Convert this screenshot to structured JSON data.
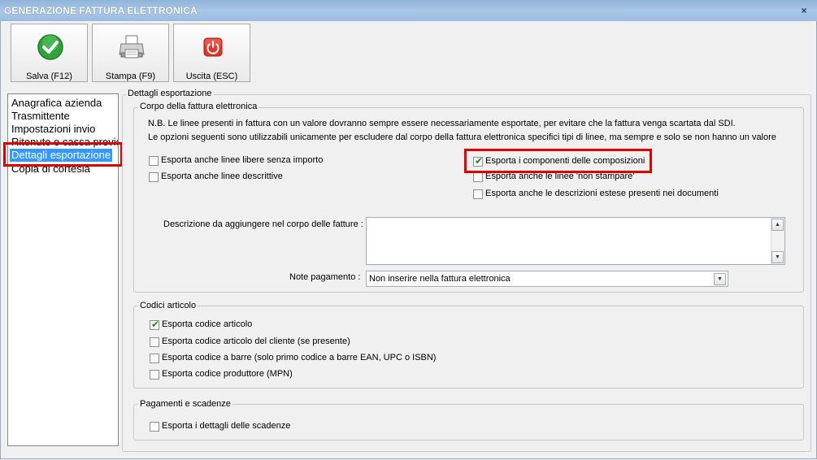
{
  "window": {
    "title": "GENERAZIONE FATTURA ELETTRONICA",
    "close_glyph": "×"
  },
  "toolbar": {
    "save_label": "Salva (F12)",
    "print_label": "Stampa (F9)",
    "exit_label": "Uscita (ESC)"
  },
  "nav": {
    "items": [
      {
        "label": "Anagrafica azienda"
      },
      {
        "label": "Trasmittente"
      },
      {
        "label": "Impostazioni invio"
      },
      {
        "label": "Ritenute e cassa previd"
      },
      {
        "label": "Dettagli esportazione"
      },
      {
        "label": "Copia di cortesia"
      }
    ],
    "selected": "Dettagli esportazione"
  },
  "main": {
    "title": "Dettagli esportazione",
    "corpo": {
      "title": "Corpo della fattura elettronica",
      "note1": "N.B. Le linee presenti in fattura con un valore dovranno sempre essere necessariamente esportate, per evitare che la fattura venga scartata dal SDI.",
      "note2": "Le opzioni seguenti sono utilizzabili unicamente per escludere dal corpo della fattura elettronica specifici tipi di linee, ma sempre e solo se non hanno un valore",
      "left_options": [
        {
          "label": "Esporta anche linee libere senza importo",
          "checked": false
        },
        {
          "label": "Esporta anche linee descrittive",
          "checked": false
        }
      ],
      "right_options": [
        {
          "label": "Esporta i componenti delle composizioni",
          "checked": true
        },
        {
          "label": "Esporta anche le linee 'non stampare'",
          "checked": false
        },
        {
          "label": "Esporta anche le descrizioni estese presenti nei documenti",
          "checked": false
        }
      ],
      "descr_label": "Descrizione da aggiungere nel corpo delle fatture :",
      "descr_value": "",
      "note_pag_label": "Note pagamento :",
      "note_pag_value": "Non inserire nella fattura elettronica"
    },
    "codici": {
      "title": "Codici articolo",
      "options": [
        {
          "label": "Esporta codice articolo",
          "checked": true
        },
        {
          "label": "Esporta codice articolo del cliente (se presente)",
          "checked": false
        },
        {
          "label": "Esporta codice a barre (solo primo codice a barre EAN, UPC o ISBN)",
          "checked": false
        },
        {
          "label": "Esporta codice produttore (MPN)",
          "checked": false
        }
      ]
    },
    "pagamenti": {
      "title": "Pagamenti e scadenze",
      "options": [
        {
          "label": "Esporta i dettagli delle scadenze",
          "checked": false
        }
      ]
    }
  },
  "colors": {
    "highlight": "#e00000",
    "selection": "#3399ff",
    "check": "#1a8a22"
  }
}
